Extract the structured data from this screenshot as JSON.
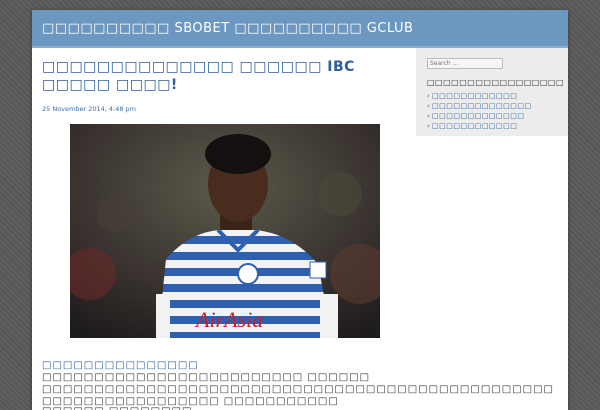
{
  "site": {
    "title": "□□□□□□□□□□ SBOBET □□□□□□□□□□ GCLUB"
  },
  "post": {
    "title": "□□□□□□□□□□□□□□ □□□□□□ IBC □□□□□ □□□□!",
    "date": "25 November 2014, 4:48 pm",
    "paragraph1_lead": "□□□□□□□□□□□□□□□",
    "paragraph1_rest": " □□□□□□□□□□□□□□□□□□□□□□□□□ □□□□□□ □□□□□□□□□□□□□□□□□□□□□□□□□□□□□□□□□□□□□□□□□□□□□□□□□ □□□□□□□□□□□□□□□□□ □□□□□□□□□□□",
    "paragraph2": "□□□□□□ □□□□□□□□ □□□□□□□□□□□□□□□□□□□□□□□"
  },
  "sidebar": {
    "search_placeholder": "Search ...",
    "widget_title": "□□□□□□□□□□□□□□□□□",
    "links": [
      "□□□□□□□□□□□□",
      "□□□□□□□□□□□□□□",
      "□□□□□□□□□□□□□",
      "□□□□□□□□□□□□"
    ]
  },
  "colors": {
    "header": "#6c97c0",
    "link": "#2a5e99",
    "sidebar_bg": "#ececec"
  }
}
